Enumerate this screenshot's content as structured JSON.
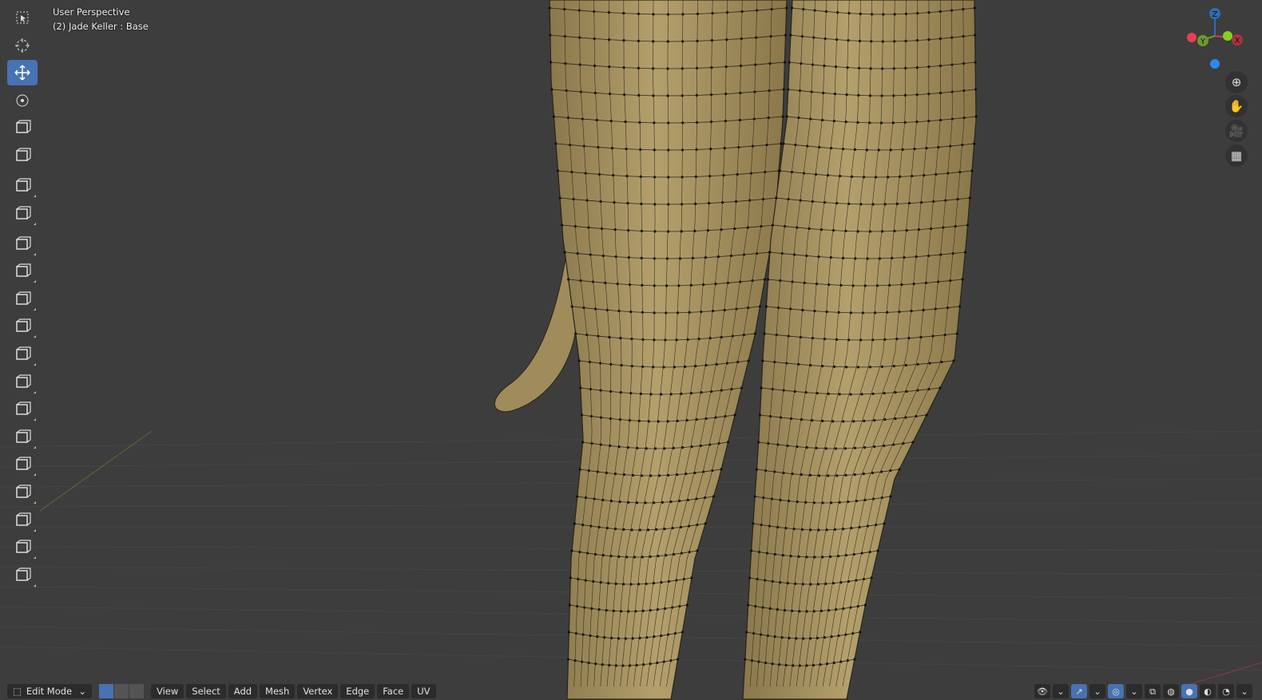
{
  "viewport": {
    "view_name": "User Perspective",
    "object_info": "(2) Jade Keller : Base",
    "mesh_color": "#a8935f",
    "background": "#3d3d3d"
  },
  "toolbar": {
    "tools": [
      {
        "name": "select-box",
        "active": false
      },
      {
        "name": "cursor",
        "active": false
      },
      {
        "name": "move",
        "active": true
      },
      {
        "name": "rotate",
        "active": false
      },
      {
        "name": "scale",
        "active": false
      },
      {
        "name": "transform",
        "active": false
      },
      {
        "name": "annotate",
        "active": false
      },
      {
        "name": "measure",
        "active": false
      },
      {
        "name": "add-cube",
        "active": false
      },
      {
        "name": "extrude-region",
        "active": false
      },
      {
        "name": "inset-faces",
        "active": false
      },
      {
        "name": "bevel",
        "active": false
      },
      {
        "name": "loop-cut",
        "active": false
      },
      {
        "name": "knife",
        "active": false
      },
      {
        "name": "poly-build",
        "active": false
      },
      {
        "name": "spin",
        "active": false
      },
      {
        "name": "smooth",
        "active": false
      },
      {
        "name": "edge-slide",
        "active": false
      },
      {
        "name": "shrink-fatten",
        "active": false
      },
      {
        "name": "shear",
        "active": false
      },
      {
        "name": "rip-region",
        "active": false
      }
    ]
  },
  "gizmo": {
    "x": "X",
    "y": "Y",
    "z": "Z",
    "x_color": "#d63c4c",
    "y_color": "#6c9b2a",
    "z_color": "#2f6db5"
  },
  "nav": {
    "zoom": "zoom-icon",
    "pan": "hand-icon",
    "camera": "camera-icon",
    "ortho": "grid-icon"
  },
  "header": {
    "mode": "Edit Mode",
    "menus": [
      "View",
      "Select",
      "Add",
      "Mesh",
      "Vertex",
      "Edge",
      "Face",
      "UV"
    ]
  }
}
